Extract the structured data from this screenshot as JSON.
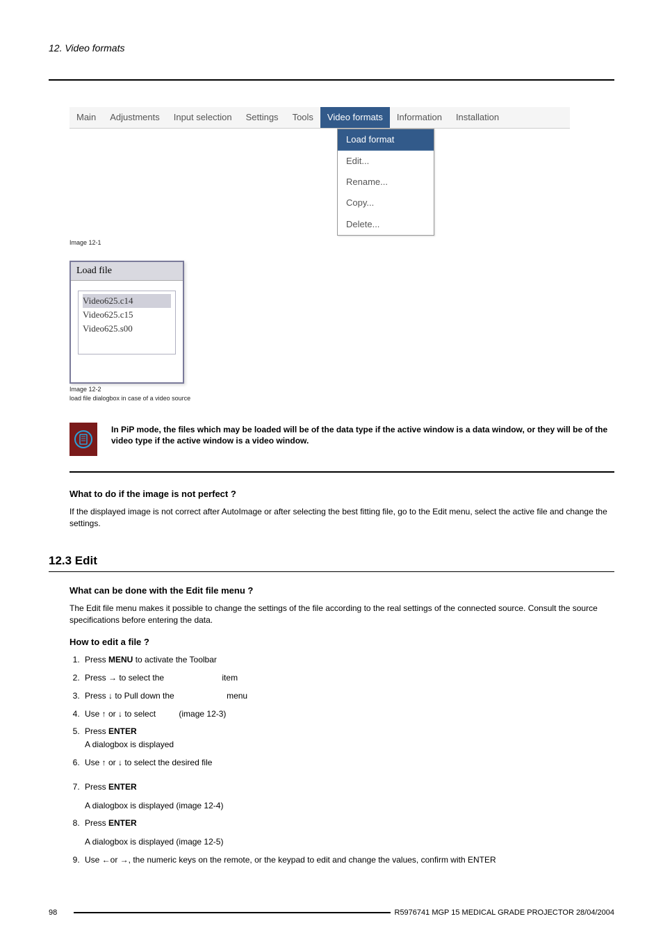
{
  "header": {
    "chapter": "12.  Video formats"
  },
  "fig1": {
    "menu": {
      "items": [
        "Main",
        "Adjustments",
        "Input selection",
        "Settings",
        "Tools",
        "Video formats",
        "Information",
        "Installation"
      ],
      "active_index": 5
    },
    "dropdown": {
      "items": [
        "Load format",
        "Edit...",
        "Rename...",
        "Copy...",
        "Delete..."
      ],
      "selected_index": 0
    },
    "caption": "Image 12-1"
  },
  "fig2": {
    "title": "Load file",
    "items": [
      "Video625.c14",
      "Video625.c15",
      "Video625.s00"
    ],
    "selected_index": 0,
    "caption_a": "Image 12-2",
    "caption_b": "load file dialogbox in case of a video source"
  },
  "note": {
    "text": "In PiP mode, the files which may be loaded will be of the data type if the active window is a data window, or they will be of the video type if the active window is a video window."
  },
  "sect_imperfect": {
    "heading": "What to do if the image is not perfect ?",
    "body": "If the displayed image is not correct after AutoImage or after selecting the best fitting file, go to the Edit menu, select the active file and change the settings."
  },
  "sect_edit": {
    "title": "12.3 Edit",
    "q1_head": "What can be done with the Edit file menu ?",
    "q1_body": "The Edit file menu makes it possible to change the settings of the file according to the real settings of the connected source. Consult the source specifications before entering the data.",
    "q2_head": "How to edit a file ?",
    "steps": {
      "s1_a": "Press ",
      "s1_b": "MENU",
      "s1_c": " to activate the Toolbar",
      "s2_a": "Press → to select the ",
      "s2_b": "item",
      "s3_a": "Press ↓ to Pull down the ",
      "s3_b": "menu",
      "s4_a": "Use ↑ or ↓ to select ",
      "s4_b": "(image 12-3)",
      "s5_a": "Press ",
      "s5_b": "ENTER",
      "s5_c": "A dialogbox is displayed",
      "s6": "Use ↑ or ↓ to select the desired file",
      "s7_a": "Press ",
      "s7_b": "ENTER",
      "s7_c": "A dialogbox is displayed (image 12-4)",
      "s8_a": "Press ",
      "s8_b": "ENTER",
      "s8_c": "A dialogbox is displayed (image 12-5)",
      "s9": "Use ←or →, the numeric keys on the remote, or the keypad to edit and change the values, confirm with ENTER"
    }
  },
  "footer": {
    "page": "98",
    "text": "R5976741  MGP 15 MEDICAL GRADE PROJECTOR  28/04/2004"
  }
}
